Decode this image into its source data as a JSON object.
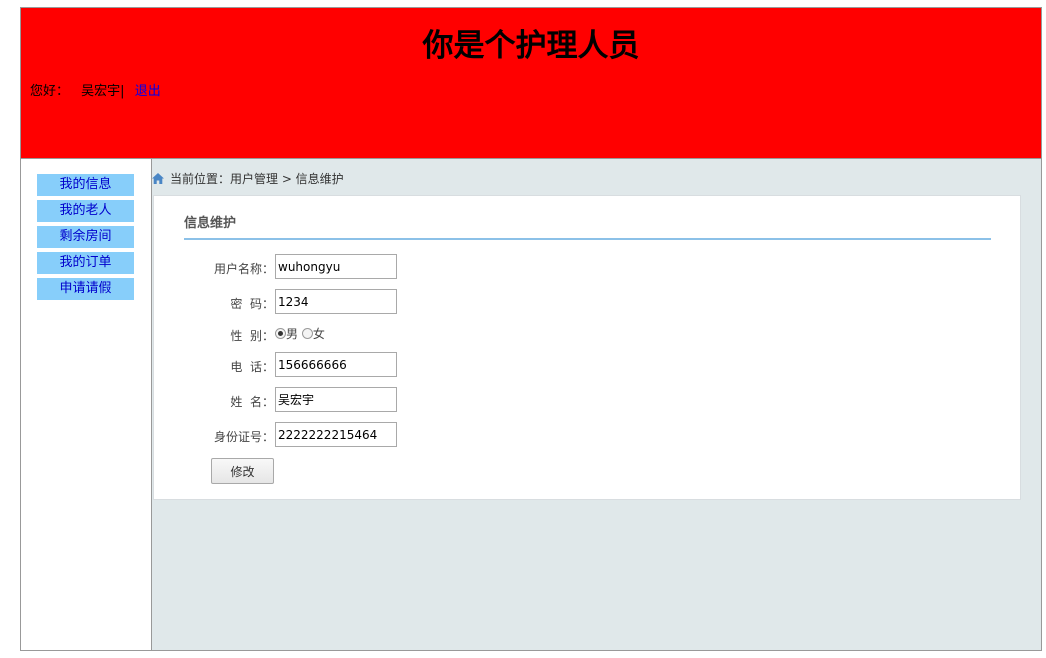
{
  "header": {
    "title": "你是个护理人员",
    "greeting_prefix": "您好：",
    "username": "吴宏宇|",
    "logout_label": "退出",
    "background_color": "#ff0000"
  },
  "sidebar": {
    "items": [
      {
        "label": "我的信息"
      },
      {
        "label": "我的老人"
      },
      {
        "label": "剩余房间"
      },
      {
        "label": "我的订单"
      },
      {
        "label": "申请请假"
      }
    ],
    "item_color": "#87cefa"
  },
  "breadcrumb": {
    "icon": "home-icon",
    "text": "当前位置：用户管理 > 信息维护"
  },
  "form": {
    "title": "信息维护",
    "fields": {
      "username": {
        "label": "用户名称：",
        "value": "wuhongyu"
      },
      "password": {
        "label": "密  码：",
        "value": "1234"
      },
      "gender": {
        "label": "性  别：",
        "options": [
          "男",
          "女"
        ],
        "selected": "男"
      },
      "phone": {
        "label": "电  话：",
        "value": "156666666"
      },
      "name": {
        "label": "姓  名：",
        "value": "吴宏宇"
      },
      "id_number": {
        "label": "身份证号：",
        "value": "2222222215464"
      }
    },
    "submit_label": "修改",
    "accent_color": "#8cc1e8"
  }
}
